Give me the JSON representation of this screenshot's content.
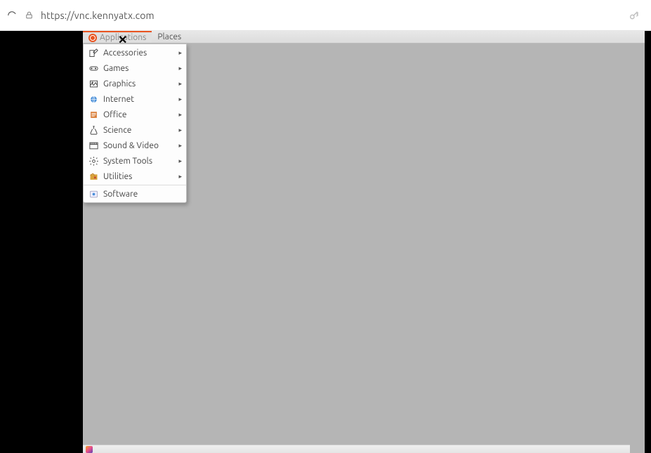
{
  "browser": {
    "url": "https://vnc.kennyatx.com"
  },
  "panel": {
    "applications": "Applications",
    "places": "Places"
  },
  "menu": {
    "items": [
      {
        "label": "Accessories",
        "icon": "accessories",
        "sub": true
      },
      {
        "label": "Games",
        "icon": "games",
        "sub": true
      },
      {
        "label": "Graphics",
        "icon": "graphics",
        "sub": true
      },
      {
        "label": "Internet",
        "icon": "internet",
        "sub": true
      },
      {
        "label": "Office",
        "icon": "office",
        "sub": true
      },
      {
        "label": "Science",
        "icon": "science",
        "sub": true
      },
      {
        "label": "Sound & Video",
        "icon": "sound-video",
        "sub": true
      },
      {
        "label": "System Tools",
        "icon": "system-tools",
        "sub": true
      },
      {
        "label": "Utilities",
        "icon": "utilities",
        "sub": true
      }
    ],
    "footer": {
      "label": "Software",
      "icon": "software"
    }
  }
}
